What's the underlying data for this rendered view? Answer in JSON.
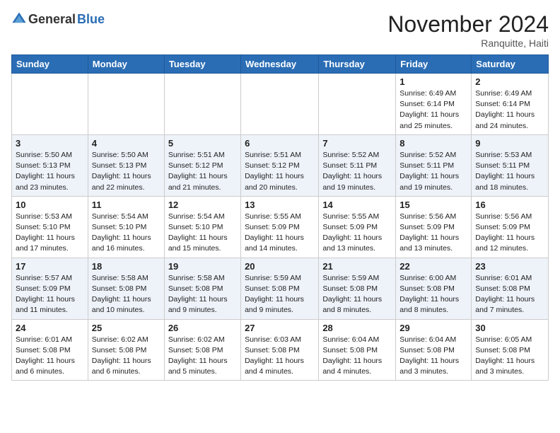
{
  "logo": {
    "general": "General",
    "blue": "Blue"
  },
  "header": {
    "month_year": "November 2024",
    "location": "Ranquitte, Haiti"
  },
  "weekdays": [
    "Sunday",
    "Monday",
    "Tuesday",
    "Wednesday",
    "Thursday",
    "Friday",
    "Saturday"
  ],
  "weeks": [
    [
      {
        "day": "",
        "info": ""
      },
      {
        "day": "",
        "info": ""
      },
      {
        "day": "",
        "info": ""
      },
      {
        "day": "",
        "info": ""
      },
      {
        "day": "",
        "info": ""
      },
      {
        "day": "1",
        "info": "Sunrise: 6:49 AM\nSunset: 6:14 PM\nDaylight: 11 hours\nand 25 minutes."
      },
      {
        "day": "2",
        "info": "Sunrise: 6:49 AM\nSunset: 6:14 PM\nDaylight: 11 hours\nand 24 minutes."
      }
    ],
    [
      {
        "day": "3",
        "info": "Sunrise: 5:50 AM\nSunset: 5:13 PM\nDaylight: 11 hours\nand 23 minutes."
      },
      {
        "day": "4",
        "info": "Sunrise: 5:50 AM\nSunset: 5:13 PM\nDaylight: 11 hours\nand 22 minutes."
      },
      {
        "day": "5",
        "info": "Sunrise: 5:51 AM\nSunset: 5:12 PM\nDaylight: 11 hours\nand 21 minutes."
      },
      {
        "day": "6",
        "info": "Sunrise: 5:51 AM\nSunset: 5:12 PM\nDaylight: 11 hours\nand 20 minutes."
      },
      {
        "day": "7",
        "info": "Sunrise: 5:52 AM\nSunset: 5:11 PM\nDaylight: 11 hours\nand 19 minutes."
      },
      {
        "day": "8",
        "info": "Sunrise: 5:52 AM\nSunset: 5:11 PM\nDaylight: 11 hours\nand 19 minutes."
      },
      {
        "day": "9",
        "info": "Sunrise: 5:53 AM\nSunset: 5:11 PM\nDaylight: 11 hours\nand 18 minutes."
      }
    ],
    [
      {
        "day": "10",
        "info": "Sunrise: 5:53 AM\nSunset: 5:10 PM\nDaylight: 11 hours\nand 17 minutes."
      },
      {
        "day": "11",
        "info": "Sunrise: 5:54 AM\nSunset: 5:10 PM\nDaylight: 11 hours\nand 16 minutes."
      },
      {
        "day": "12",
        "info": "Sunrise: 5:54 AM\nSunset: 5:10 PM\nDaylight: 11 hours\nand 15 minutes."
      },
      {
        "day": "13",
        "info": "Sunrise: 5:55 AM\nSunset: 5:09 PM\nDaylight: 11 hours\nand 14 minutes."
      },
      {
        "day": "14",
        "info": "Sunrise: 5:55 AM\nSunset: 5:09 PM\nDaylight: 11 hours\nand 13 minutes."
      },
      {
        "day": "15",
        "info": "Sunrise: 5:56 AM\nSunset: 5:09 PM\nDaylight: 11 hours\nand 13 minutes."
      },
      {
        "day": "16",
        "info": "Sunrise: 5:56 AM\nSunset: 5:09 PM\nDaylight: 11 hours\nand 12 minutes."
      }
    ],
    [
      {
        "day": "17",
        "info": "Sunrise: 5:57 AM\nSunset: 5:09 PM\nDaylight: 11 hours\nand 11 minutes."
      },
      {
        "day": "18",
        "info": "Sunrise: 5:58 AM\nSunset: 5:08 PM\nDaylight: 11 hours\nand 10 minutes."
      },
      {
        "day": "19",
        "info": "Sunrise: 5:58 AM\nSunset: 5:08 PM\nDaylight: 11 hours\nand 9 minutes."
      },
      {
        "day": "20",
        "info": "Sunrise: 5:59 AM\nSunset: 5:08 PM\nDaylight: 11 hours\nand 9 minutes."
      },
      {
        "day": "21",
        "info": "Sunrise: 5:59 AM\nSunset: 5:08 PM\nDaylight: 11 hours\nand 8 minutes."
      },
      {
        "day": "22",
        "info": "Sunrise: 6:00 AM\nSunset: 5:08 PM\nDaylight: 11 hours\nand 8 minutes."
      },
      {
        "day": "23",
        "info": "Sunrise: 6:01 AM\nSunset: 5:08 PM\nDaylight: 11 hours\nand 7 minutes."
      }
    ],
    [
      {
        "day": "24",
        "info": "Sunrise: 6:01 AM\nSunset: 5:08 PM\nDaylight: 11 hours\nand 6 minutes."
      },
      {
        "day": "25",
        "info": "Sunrise: 6:02 AM\nSunset: 5:08 PM\nDaylight: 11 hours\nand 6 minutes."
      },
      {
        "day": "26",
        "info": "Sunrise: 6:02 AM\nSunset: 5:08 PM\nDaylight: 11 hours\nand 5 minutes."
      },
      {
        "day": "27",
        "info": "Sunrise: 6:03 AM\nSunset: 5:08 PM\nDaylight: 11 hours\nand 4 minutes."
      },
      {
        "day": "28",
        "info": "Sunrise: 6:04 AM\nSunset: 5:08 PM\nDaylight: 11 hours\nand 4 minutes."
      },
      {
        "day": "29",
        "info": "Sunrise: 6:04 AM\nSunset: 5:08 PM\nDaylight: 11 hours\nand 3 minutes."
      },
      {
        "day": "30",
        "info": "Sunrise: 6:05 AM\nSunset: 5:08 PM\nDaylight: 11 hours\nand 3 minutes."
      }
    ]
  ]
}
